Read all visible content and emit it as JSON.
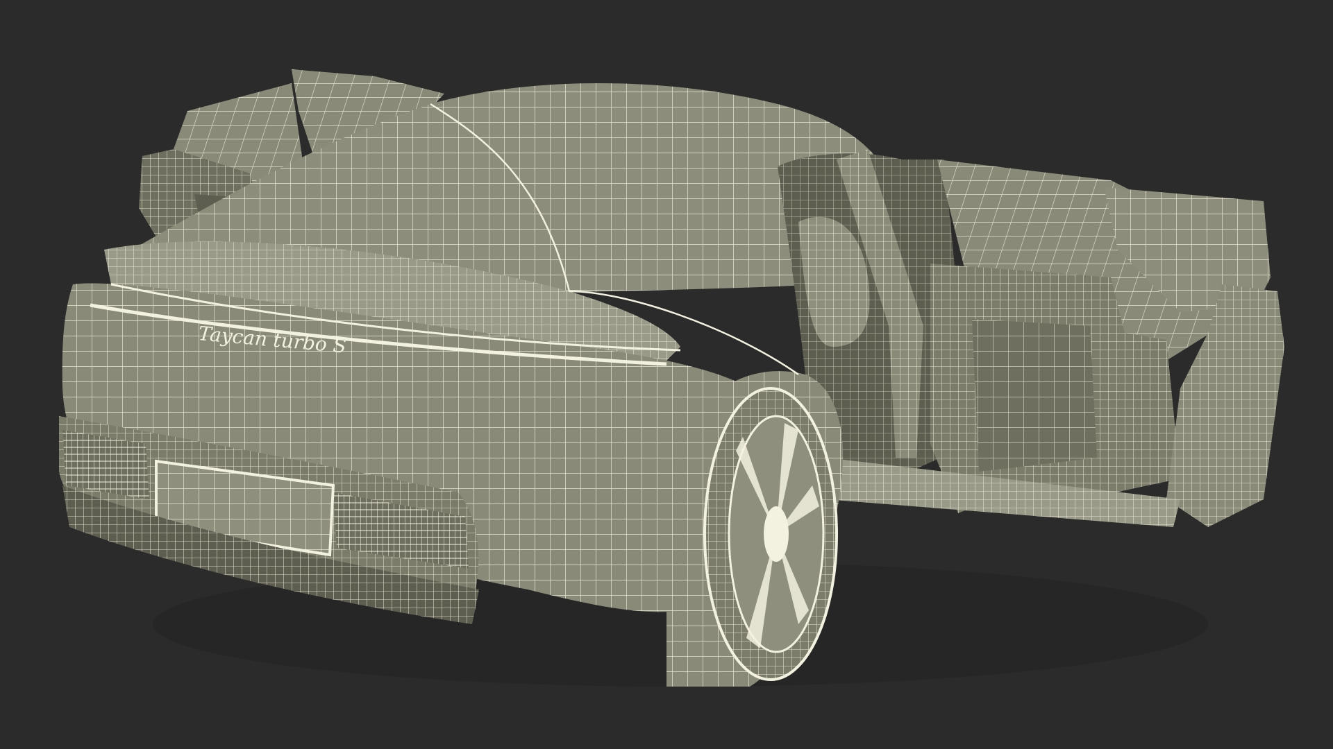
{
  "scene": {
    "background_color": "#2b2b2b",
    "surface_color": "#8a8a78",
    "surface_dark": "#6f6f5f",
    "surface_light": "#9a9a88",
    "wire_color": "#f3f1df",
    "cavity_color": "#5e5e50"
  },
  "car": {
    "badge": "Taycan turbo S"
  }
}
